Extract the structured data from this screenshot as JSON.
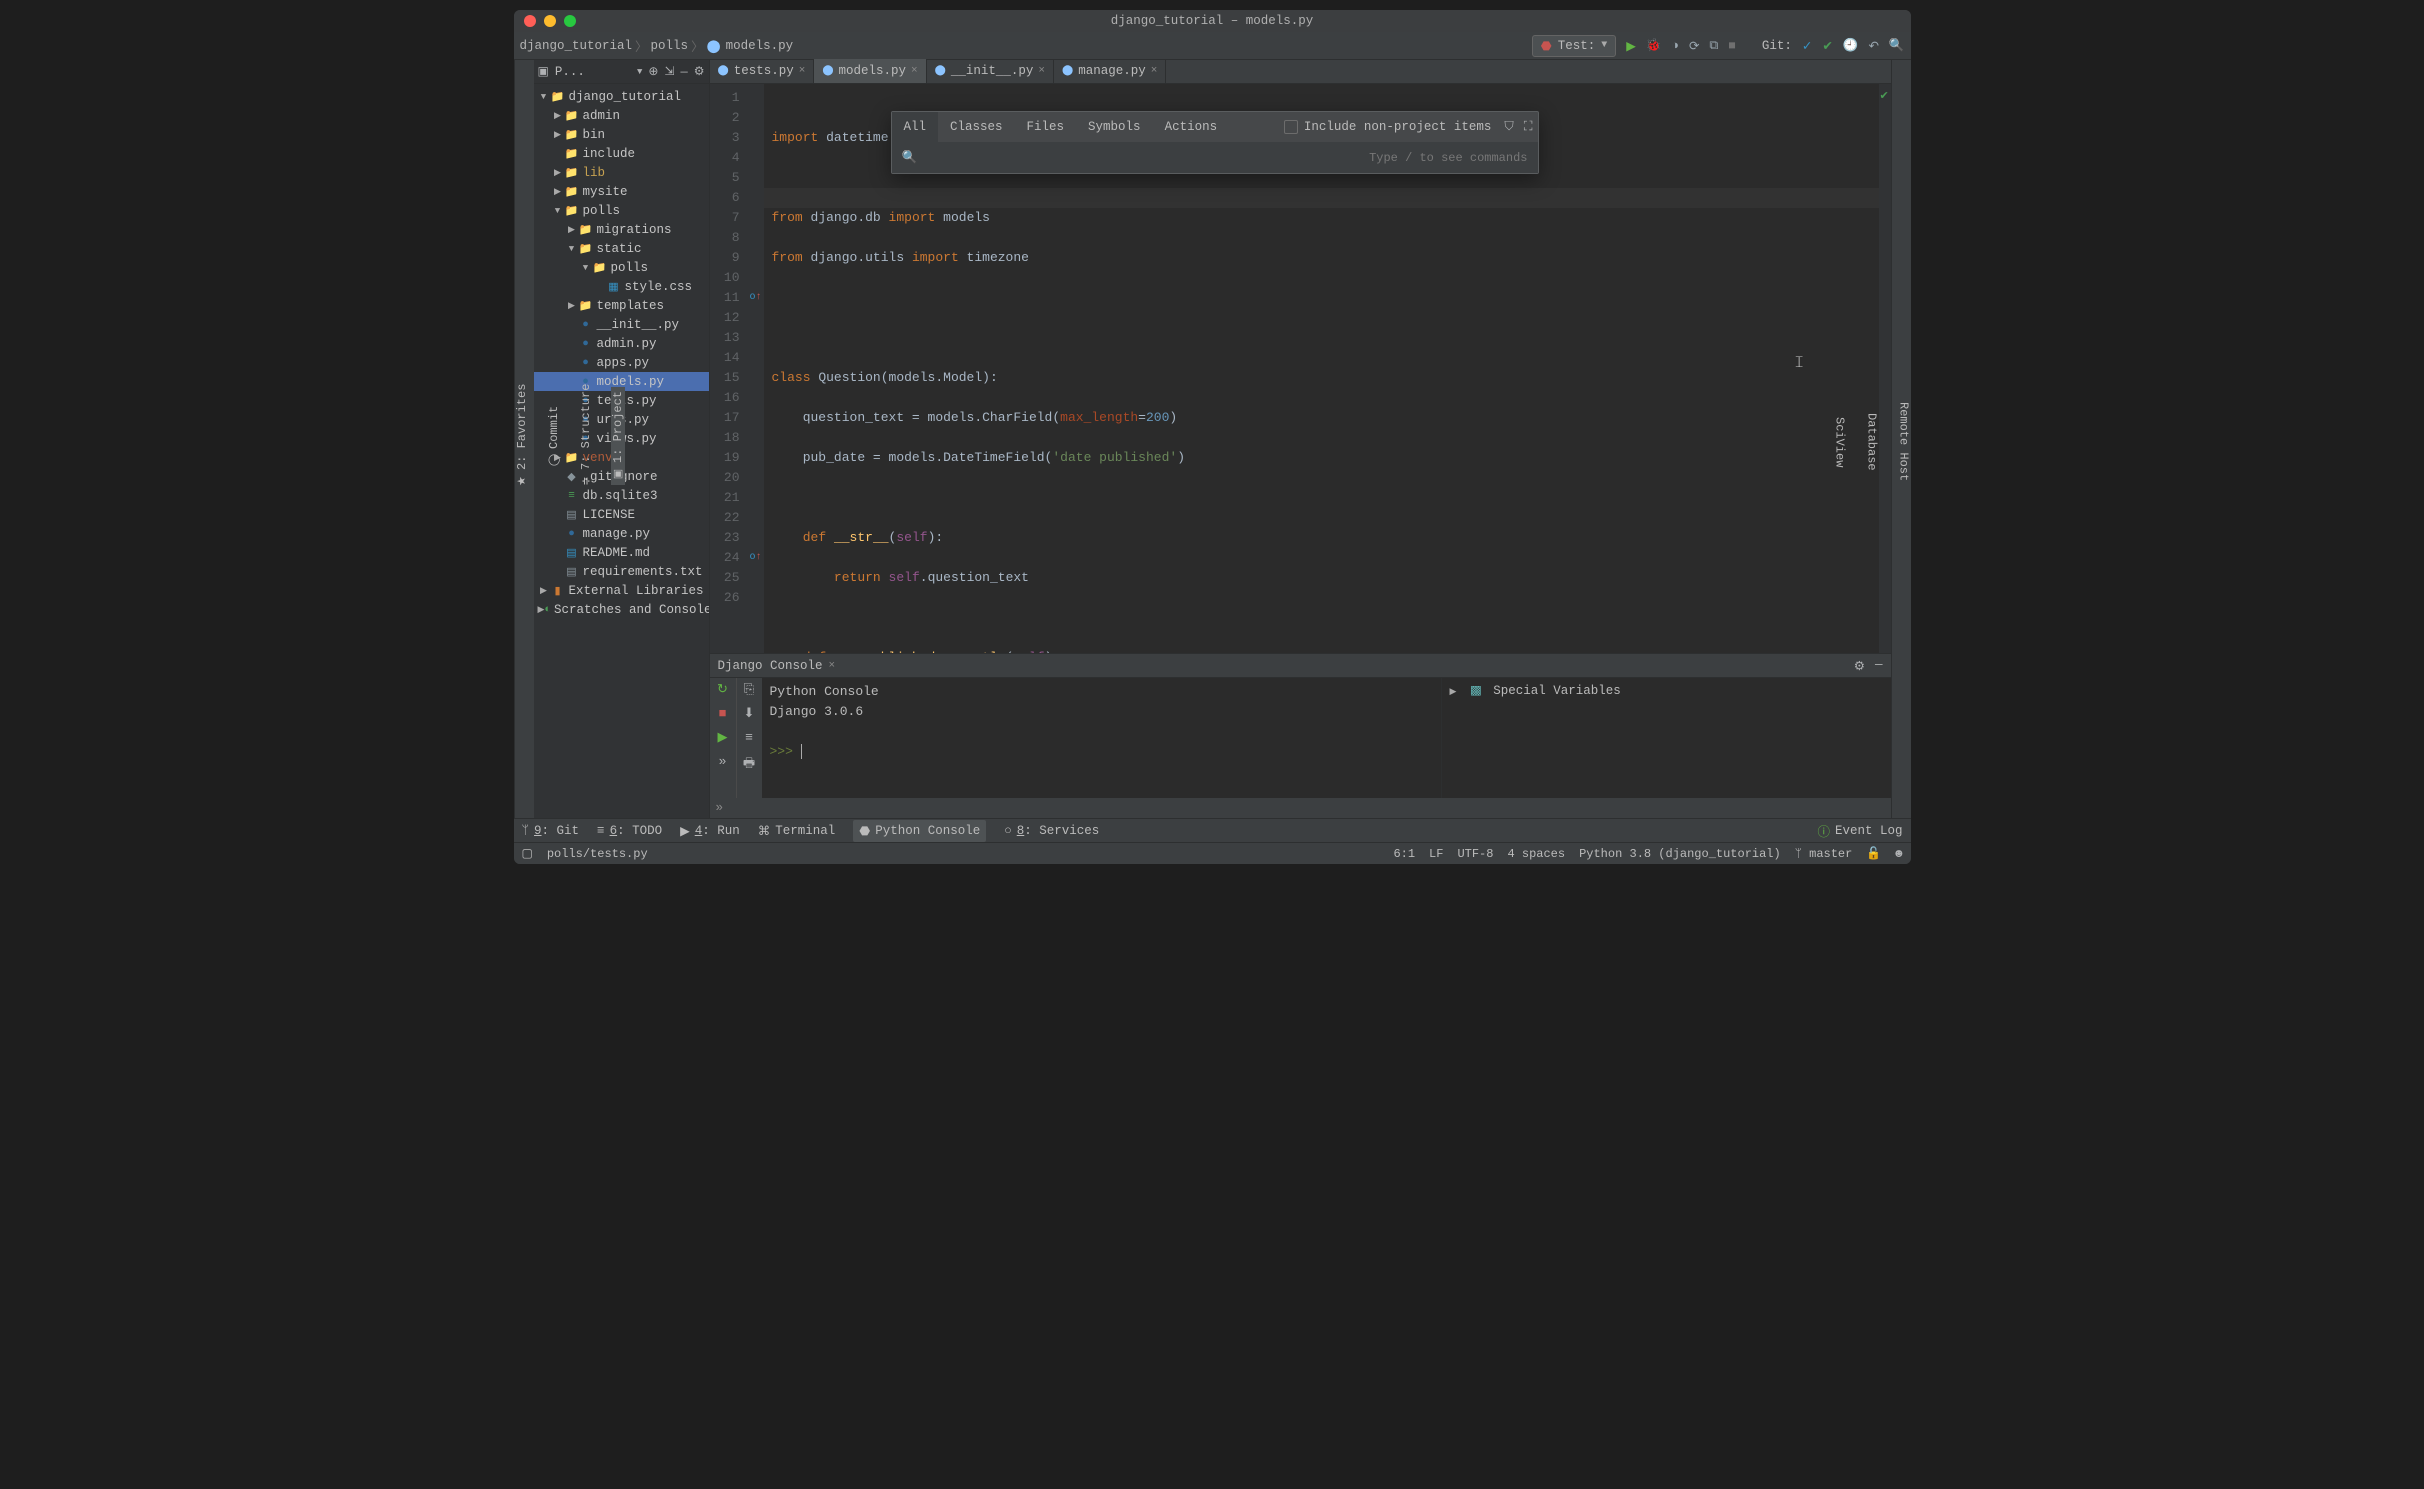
{
  "window_title": "django_tutorial – models.py",
  "breadcrumbs": {
    "a": "django_tutorial",
    "b": "polls",
    "c": "models.py"
  },
  "run_config": "Test:",
  "git_label": "Git:",
  "left_tabs": {
    "project": "1: Project",
    "structure": "7: Structure",
    "commit": "Commit",
    "favorites": "2: Favorites"
  },
  "right_tabs": {
    "remote": "Remote Host",
    "database": "Database",
    "sciview": "SciView"
  },
  "project_header": "P...",
  "tree": [
    {
      "pad": 0,
      "exp": "▼",
      "icon": "📁",
      "cls": "fc-diro",
      "name": "django_tutorial"
    },
    {
      "pad": 1,
      "exp": "▶",
      "icon": "📁",
      "cls": "fc-dir",
      "name": "admin"
    },
    {
      "pad": 1,
      "exp": "▶",
      "icon": "📁",
      "cls": "fc-dir",
      "name": "bin"
    },
    {
      "pad": 1,
      "exp": "",
      "icon": "📁",
      "cls": "fc-dir",
      "name": "include"
    },
    {
      "pad": 1,
      "exp": "▶",
      "icon": "📁",
      "cls": "fc-bluelib",
      "name": "lib",
      "ncls": "blue"
    },
    {
      "pad": 1,
      "exp": "▶",
      "icon": "📁",
      "cls": "fc-dir",
      "name": "mysite"
    },
    {
      "pad": 1,
      "exp": "▼",
      "icon": "📁",
      "cls": "fc-dir",
      "name": "polls"
    },
    {
      "pad": 2,
      "exp": "▶",
      "icon": "📁",
      "cls": "fc-dir",
      "name": "migrations"
    },
    {
      "pad": 2,
      "exp": "▼",
      "icon": "📁",
      "cls": "fc-dir",
      "name": "static"
    },
    {
      "pad": 3,
      "exp": "▼",
      "icon": "📁",
      "cls": "fc-dir",
      "name": "polls"
    },
    {
      "pad": 4,
      "exp": "",
      "icon": "▦",
      "cls": "fc-bluelib",
      "name": "style.css"
    },
    {
      "pad": 2,
      "exp": "▶",
      "icon": "📁",
      "cls": "fc-purple",
      "name": "templates"
    },
    {
      "pad": 2,
      "exp": "",
      "icon": "●",
      "cls": "fc-py",
      "name": "__init__.py"
    },
    {
      "pad": 2,
      "exp": "",
      "icon": "●",
      "cls": "fc-py",
      "name": "admin.py"
    },
    {
      "pad": 2,
      "exp": "",
      "icon": "●",
      "cls": "fc-py",
      "name": "apps.py"
    },
    {
      "pad": 2,
      "exp": "",
      "icon": "●",
      "cls": "fc-py",
      "name": "models.py",
      "sel": true
    },
    {
      "pad": 2,
      "exp": "",
      "icon": "●",
      "cls": "fc-py",
      "name": "tests.py"
    },
    {
      "pad": 2,
      "exp": "",
      "icon": "●",
      "cls": "fc-py",
      "name": "urls.py"
    },
    {
      "pad": 2,
      "exp": "",
      "icon": "●",
      "cls": "fc-py",
      "name": "views.py"
    },
    {
      "pad": 1,
      "exp": "▶",
      "icon": "📁",
      "cls": "fc-orange",
      "name": "venv",
      "ncls": "excl"
    },
    {
      "pad": 1,
      "exp": "",
      "icon": "◆",
      "cls": "fc-txt",
      "name": ".gitignore"
    },
    {
      "pad": 1,
      "exp": "",
      "icon": "≡",
      "cls": "fc-db",
      "name": "db.sqlite3"
    },
    {
      "pad": 1,
      "exp": "",
      "icon": "▤",
      "cls": "fc-txt",
      "name": "LICENSE"
    },
    {
      "pad": 1,
      "exp": "",
      "icon": "●",
      "cls": "fc-py",
      "name": "manage.py"
    },
    {
      "pad": 1,
      "exp": "",
      "icon": "▤",
      "cls": "fc-bluelib",
      "name": "README.md"
    },
    {
      "pad": 1,
      "exp": "",
      "icon": "▤",
      "cls": "fc-txt",
      "name": "requirements.txt"
    },
    {
      "pad": 0,
      "exp": "▶",
      "icon": "▮",
      "cls": "fc-orange",
      "name": "External Libraries"
    },
    {
      "pad": 0,
      "exp": "▶",
      "icon": "◐",
      "cls": "fc-db",
      "name": "Scratches and Consoles"
    }
  ],
  "editor_tabs": [
    {
      "name": "tests.py",
      "active": false
    },
    {
      "name": "models.py",
      "active": true
    },
    {
      "name": "__init__.py",
      "active": false
    },
    {
      "name": "manage.py",
      "active": false
    }
  ],
  "code_lines": 26,
  "popup": {
    "tabs": {
      "all": "All",
      "classes": "Classes",
      "files": "Files",
      "symbols": "Symbols",
      "actions": "Actions"
    },
    "checkbox": "Include non-project items",
    "hint": "Type / to see commands",
    "placeholder": ""
  },
  "console": {
    "title": "Django Console",
    "line1": "Python Console",
    "line2": "Django 3.0.6",
    "prompt": ">>>",
    "special": "Special Variables"
  },
  "bottom_tabs": {
    "git": "9: Git",
    "todo": "6: TODO",
    "run": "4: Run",
    "terminal": "Terminal",
    "pyconsole": "Python Console",
    "services": "8: Services"
  },
  "event_log": "Event Log",
  "status": {
    "path": "polls/tests.py",
    "pos": "6:1",
    "lf": "LF",
    "enc": "UTF-8",
    "indent": "4 spaces",
    "interp": "Python 3.8 (django_tutorial)",
    "branch": "master"
  }
}
